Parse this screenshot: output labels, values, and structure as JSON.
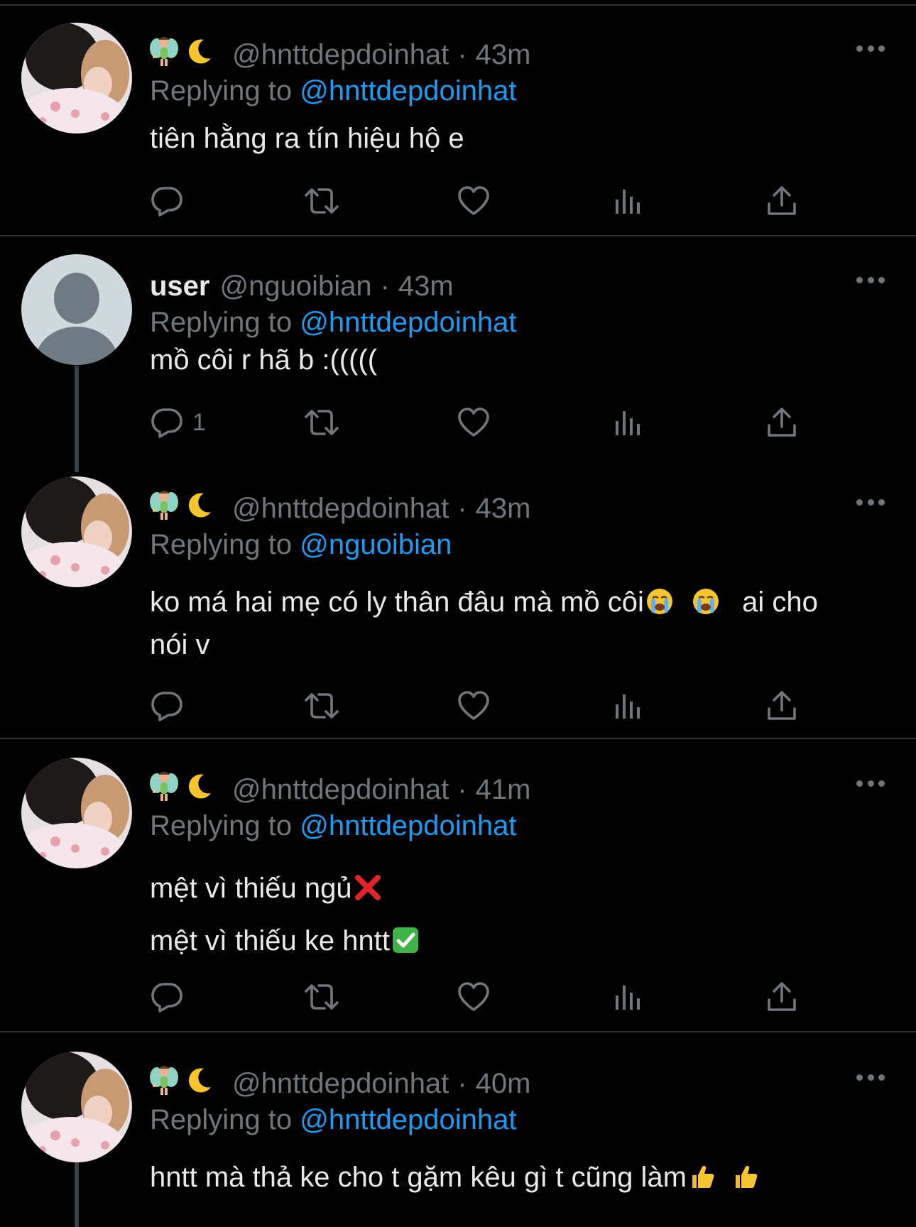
{
  "colors": {
    "background": "#000000",
    "text": "#e7e9ea",
    "secondary": "#71767b",
    "mention": "#1d9bf0",
    "separator": "#2f3336"
  },
  "tweets": [
    {
      "display_name_emoji": [
        "fairy-emoji",
        "crescent-moon-emoji"
      ],
      "handle": "@hnttdepdoinhat",
      "dot": "·",
      "time": "43m",
      "replying_prefix": "Replying to ",
      "replying_to": "@hnttdepdoinhat",
      "lines": [
        "tiên hằng ra tín hiệu hộ e"
      ],
      "reply_count": ""
    },
    {
      "display_name": "user",
      "handle": "@nguoibian",
      "dot": "·",
      "time": "43m",
      "replying_prefix": "Replying to ",
      "replying_to": "@hnttdepdoinhat",
      "lines": [
        "mồ côi r hã b :((((("
      ],
      "reply_count": "1"
    },
    {
      "display_name_emoji": [
        "fairy-emoji",
        "crescent-moon-emoji"
      ],
      "handle": "@hnttdepdoinhat",
      "dot": "·",
      "time": "43m",
      "replying_prefix": "Replying to ",
      "replying_to": "@nguoibian",
      "lines": [
        "ko má hai mẹ có ly thân đâu mà mồ côi",
        "ai cho",
        "nói v"
      ],
      "line_emoji": [
        "loudly-crying-face-emoji",
        "loudly-crying-face-emoji"
      ],
      "reply_count": ""
    },
    {
      "display_name_emoji": [
        "fairy-emoji",
        "crescent-moon-emoji"
      ],
      "handle": "@hnttdepdoinhat",
      "dot": "·",
      "time": "41m",
      "replying_prefix": "Replying to ",
      "replying_to": "@hnttdepdoinhat",
      "lines": [
        "mệt vì thiếu ngủ",
        "mệt vì thiếu ke hntt"
      ],
      "line_emoji": [
        "cross-mark-emoji",
        "check-mark-button-emoji"
      ],
      "reply_count": ""
    },
    {
      "display_name_emoji": [
        "fairy-emoji",
        "crescent-moon-emoji"
      ],
      "handle": "@hnttdepdoinhat",
      "dot": "·",
      "time": "40m",
      "replying_prefix": "Replying to ",
      "replying_to": "@hnttdepdoinhat",
      "lines": [
        "hntt mà thả ke cho t gặm kêu gì t cũng làm"
      ],
      "line_emoji": [
        "thumbs-up-emoji",
        "thumbs-up-emoji"
      ],
      "reply_count": ""
    }
  ],
  "action_icons": [
    "reply-icon",
    "retweet-icon",
    "like-icon",
    "views-icon",
    "share-icon"
  ]
}
